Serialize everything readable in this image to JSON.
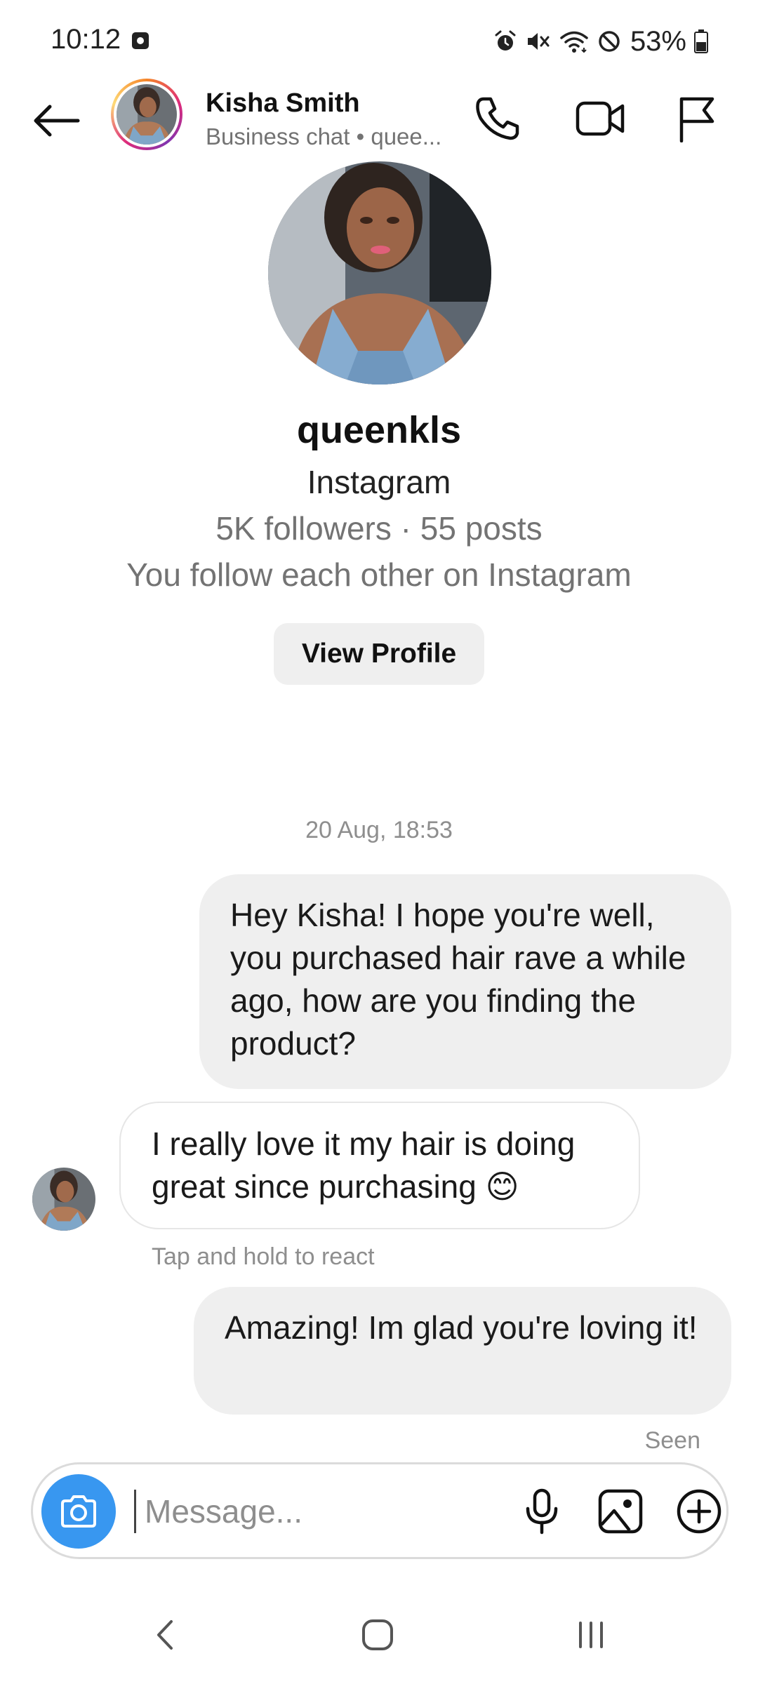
{
  "status_bar": {
    "time": "10:12",
    "battery_percent": "53%",
    "battery_level": 0.53
  },
  "header": {
    "name": "Kisha Smith",
    "subtitle": "Business chat • quee..."
  },
  "profile": {
    "username": "queenkls",
    "platform": "Instagram",
    "stats": "5K followers · 55 posts",
    "mutual": "You follow each other on Instagram",
    "view_profile_label": "View Profile"
  },
  "conversation": {
    "timestamp": "20 Aug, 18:53",
    "messages": [
      {
        "direction": "sent",
        "text": "Hey Kisha! I hope you're well, you purchased hair rave a while ago, how are you finding the product?"
      },
      {
        "direction": "received",
        "text": "I really love it my hair is doing great since purchasing 😊"
      },
      {
        "direction": "sent",
        "text": "Amazing! Im glad you're loving it!"
      }
    ],
    "hint": "Tap and hold to react",
    "seen": "Seen"
  },
  "composer": {
    "placeholder": "Message..."
  },
  "colors": {
    "accent_blue": "#3897f0",
    "sent_bubble": "#efefef",
    "secondary_text": "#737373"
  },
  "icons": {
    "back": "arrow-left-icon",
    "call": "phone-icon",
    "video": "video-camera-icon",
    "report": "flag-icon",
    "camera": "camera-icon",
    "mic": "microphone-icon",
    "gallery": "image-icon",
    "more": "plus-circle-icon"
  }
}
